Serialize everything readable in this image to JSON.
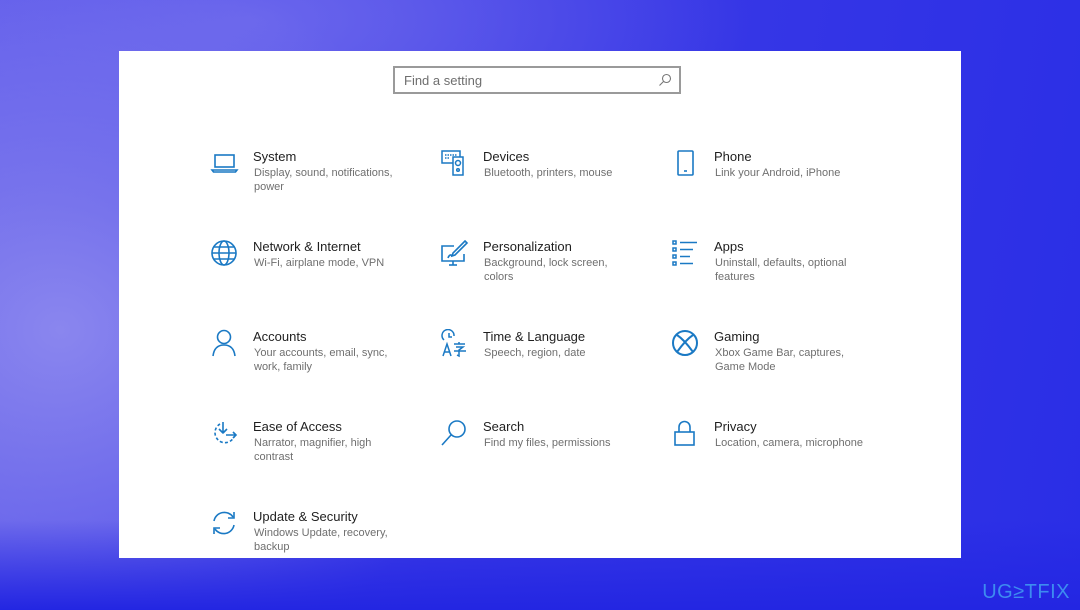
{
  "search": {
    "placeholder": "Find a setting",
    "value": ""
  },
  "accent_color": "#1a79c4",
  "tiles": [
    {
      "id": "system",
      "icon": "laptop-icon",
      "title": "System",
      "desc": "Display, sound, notifications, power"
    },
    {
      "id": "devices",
      "icon": "devices-icon",
      "title": "Devices",
      "desc": "Bluetooth, printers, mouse"
    },
    {
      "id": "phone",
      "icon": "phone-icon",
      "title": "Phone",
      "desc": "Link your Android, iPhone"
    },
    {
      "id": "network",
      "icon": "globe-icon",
      "title": "Network & Internet",
      "desc": "Wi-Fi, airplane mode, VPN"
    },
    {
      "id": "personalization",
      "icon": "paintbrush-monitor-icon",
      "title": "Personalization",
      "desc": "Background, lock screen, colors"
    },
    {
      "id": "apps",
      "icon": "apps-list-icon",
      "title": "Apps",
      "desc": "Uninstall, defaults, optional features"
    },
    {
      "id": "accounts",
      "icon": "person-icon",
      "title": "Accounts",
      "desc": "Your accounts, email, sync, work, family"
    },
    {
      "id": "time-language",
      "icon": "time-language-icon",
      "title": "Time & Language",
      "desc": "Speech, region, date"
    },
    {
      "id": "gaming",
      "icon": "xbox-icon",
      "title": "Gaming",
      "desc": "Xbox Game Bar, captures, Game Mode"
    },
    {
      "id": "ease-of-access",
      "icon": "ease-of-access-icon",
      "title": "Ease of Access",
      "desc": "Narrator, magnifier, high contrast"
    },
    {
      "id": "search",
      "icon": "magnifier-icon",
      "title": "Search",
      "desc": "Find my files, permissions"
    },
    {
      "id": "privacy",
      "icon": "lock-icon",
      "title": "Privacy",
      "desc": "Location, camera, microphone"
    },
    {
      "id": "update-security",
      "icon": "sync-arrows-icon",
      "title": "Update & Security",
      "desc": "Windows Update, recovery, backup"
    }
  ],
  "watermark": "UG≥TFIX"
}
